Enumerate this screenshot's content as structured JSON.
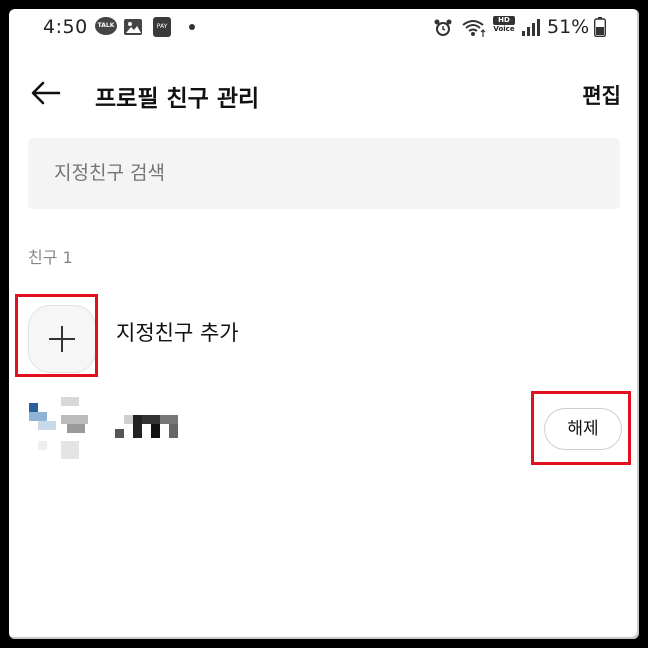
{
  "status_bar": {
    "time": "4:50",
    "talk_icon_text": "TALK",
    "pay_icon_text": "PAY",
    "hd_text": "HD",
    "voice_text": "Voice",
    "battery": "51%"
  },
  "header": {
    "title": "프로필 친구 관리",
    "edit_label": "편집"
  },
  "search": {
    "placeholder": "지정친구 검색"
  },
  "section": {
    "label": "친구 1"
  },
  "add_friend": {
    "label": "지정친구 추가"
  },
  "friends": [
    {
      "unlink_label": "해제"
    }
  ],
  "colors": {
    "highlight": "#e01020",
    "search_bg": "#f4f4f4"
  }
}
